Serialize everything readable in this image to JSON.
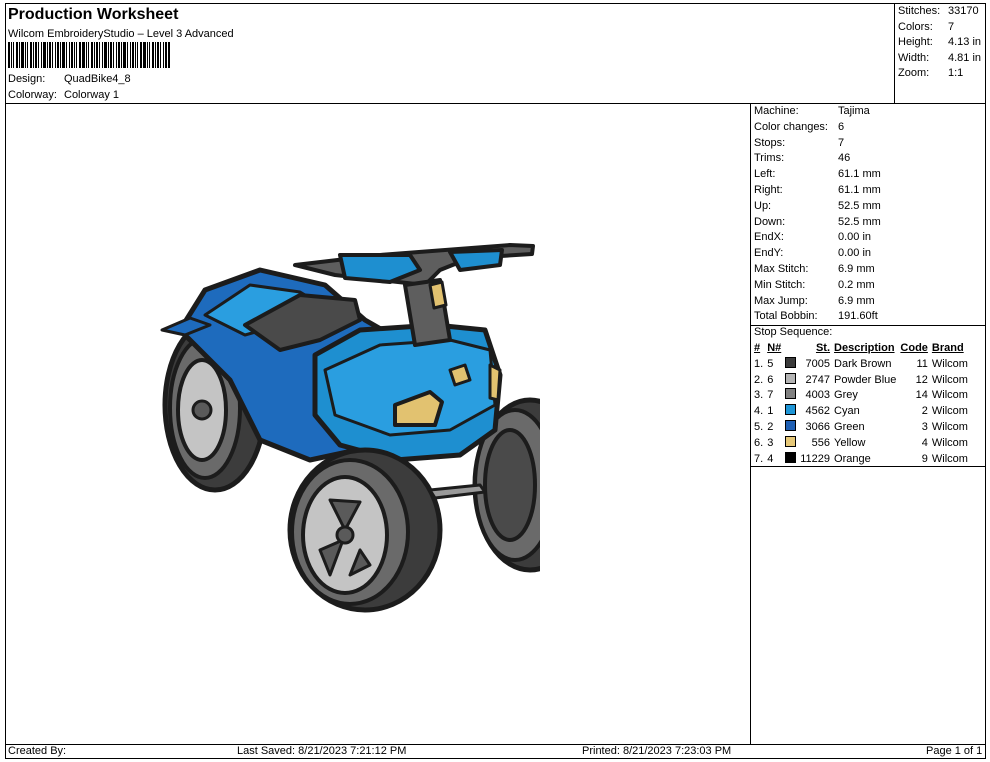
{
  "header": {
    "title": "Production Worksheet",
    "subtitle": "Wilcom EmbroideryStudio – Level 3 Advanced",
    "design_label": "Design:",
    "design_value": "QuadBike4_8",
    "colorway_label": "Colorway:",
    "colorway_value": "Colorway 1"
  },
  "summary": {
    "stitches_label": "Stitches:",
    "stitches_value": "33170",
    "colors_label": "Colors:",
    "colors_value": "7",
    "height_label": "Height:",
    "height_value": "4.13 in",
    "width_label": "Width:",
    "width_value": "4.81 in",
    "zoom_label": "Zoom:",
    "zoom_value": "1:1"
  },
  "stats": [
    {
      "k": "Machine:",
      "v": "Tajima"
    },
    {
      "k": "Color changes:",
      "v": "6"
    },
    {
      "k": "Stops:",
      "v": "7"
    },
    {
      "k": "Trims:",
      "v": "46"
    },
    {
      "k": "Left:",
      "v": "61.1 mm"
    },
    {
      "k": "Right:",
      "v": "61.1 mm"
    },
    {
      "k": "Up:",
      "v": "52.5 mm"
    },
    {
      "k": "Down:",
      "v": "52.5 mm"
    },
    {
      "k": "EndX:",
      "v": "0.00 in"
    },
    {
      "k": "EndY:",
      "v": "0.00 in"
    },
    {
      "k": "Max Stitch:",
      "v": "6.9 mm"
    },
    {
      "k": "Min Stitch:",
      "v": "0.2 mm"
    },
    {
      "k": "Max Jump:",
      "v": "6.9 mm"
    },
    {
      "k": "Total Bobbin:",
      "v": "191.60ft"
    }
  ],
  "stop_sequence": {
    "title": "Stop Sequence:",
    "headers": {
      "num": "#",
      "n": "N#",
      "st": "St.",
      "desc": "Description",
      "code": "Code",
      "brand": "Brand"
    },
    "rows": [
      {
        "num": "1.",
        "n": "5",
        "color": "#3a3a3a",
        "st": "7005",
        "desc": "Dark Brown",
        "code": "11",
        "brand": "Wilcom"
      },
      {
        "num": "2.",
        "n": "6",
        "color": "#b4b4b4",
        "st": "2747",
        "desc": "Powder Blue",
        "code": "12",
        "brand": "Wilcom"
      },
      {
        "num": "3.",
        "n": "7",
        "color": "#808080",
        "st": "4003",
        "desc": "Grey",
        "code": "14",
        "brand": "Wilcom"
      },
      {
        "num": "4.",
        "n": "1",
        "color": "#1e96d7",
        "st": "4562",
        "desc": "Cyan",
        "code": "2",
        "brand": "Wilcom"
      },
      {
        "num": "5.",
        "n": "2",
        "color": "#1e5fb4",
        "st": "3066",
        "desc": "Green",
        "code": "3",
        "brand": "Wilcom"
      },
      {
        "num": "6.",
        "n": "3",
        "color": "#e6c878",
        "st": "556",
        "desc": "Yellow",
        "code": "4",
        "brand": "Wilcom"
      },
      {
        "num": "7.",
        "n": "4",
        "color": "#000000",
        "st": "11229",
        "desc": "Orange",
        "code": "9",
        "brand": "Wilcom"
      }
    ]
  },
  "footer": {
    "created": "Created By:",
    "saved": "Last Saved: 8/21/2023 7:21:12 PM",
    "printed": "Printed: 8/21/2023 7:23:03 PM",
    "page": "Page 1 of 1"
  }
}
